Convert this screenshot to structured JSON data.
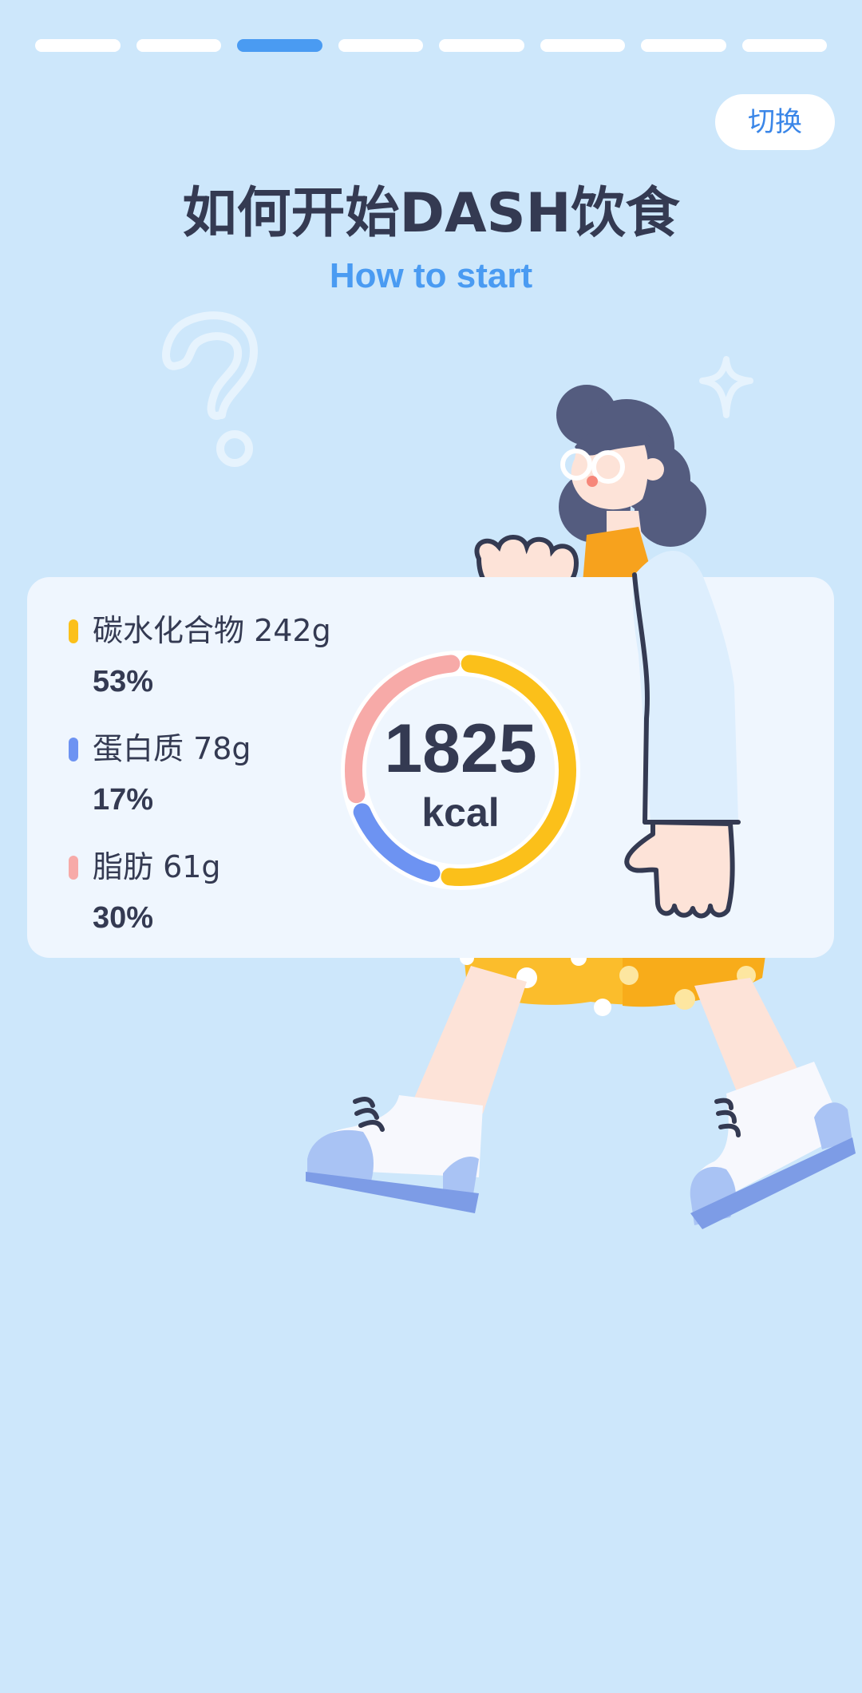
{
  "progress": {
    "total": 8,
    "current_index": 2
  },
  "header": {
    "switch_label": "切换"
  },
  "title": "如何开始DASH饮食",
  "subtitle": "How to start",
  "nutrition": {
    "calories_value": "1825",
    "calories_unit": "kcal",
    "macros": [
      {
        "name": "碳水化合物 242g",
        "percent_label": "53%",
        "percent": 53,
        "color": "#fbc01a"
      },
      {
        "name": "蛋白质 78g",
        "percent_label": "17%",
        "percent": 17,
        "color": "#6d93f2"
      },
      {
        "name": "脂肪 61g",
        "percent_label": "30%",
        "percent": 30,
        "color": "#f7aaa8"
      }
    ]
  },
  "colors": {
    "background": "#cde7fb",
    "accent": "#4a9bf2",
    "text": "#343a52",
    "card": "#eff6fe"
  },
  "icons": {
    "question": "question-mark-decoration-icon",
    "sparkle": "sparkle-star-icon"
  }
}
